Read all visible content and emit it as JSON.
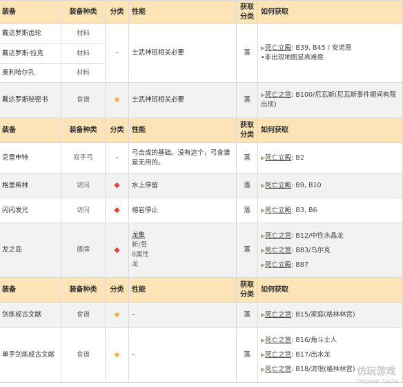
{
  "headers": {
    "equip": "装备",
    "type": "装备种类",
    "cat": "分类",
    "perf": "性能",
    "get1": "获取",
    "get2": "分类",
    "how": "如何获取"
  },
  "rows": [
    {
      "name": "戴达罗斯齿轮",
      "type": "材料"
    },
    {
      "name": "戴达罗斯·拉克",
      "type": "材料"
    },
    {
      "name": "奥利哈尔孔",
      "type": "材料"
    }
  ],
  "group1": {
    "cat": "–",
    "perf": "士武神班相关必要",
    "get": "落",
    "src1_prefix": "▶",
    "src1_link": "死亡立殿",
    "src1_rest": ": B39, B45 / 安诺恩",
    "src2": "•非出现地图是高难度"
  },
  "secret": {
    "name": "戴达罗斯秘密书",
    "type": "食谱",
    "cat": "★",
    "perf": "士武神班相关必要",
    "get": "落",
    "src_link": "死亡之宫",
    "src_rest": ": B100/尼瓦斯(尼瓦斯事件期间有限",
    "src_rest2": "出现)"
  },
  "sec2": [
    {
      "name": "克雷申特",
      "type": "双手弓",
      "cat": "–",
      "perf1": "弓合成的基础。没有这个，弓食谱",
      "perf2": "是无用的。",
      "get": "落",
      "link": "死亡立殿",
      "rest": ": B2"
    },
    {
      "name": "格里希林",
      "type": "访问",
      "cat": "◆",
      "perf1": "水上停留",
      "perf2": "",
      "get": "落",
      "link": "死亡立殿",
      "rest": ": B9, B10"
    },
    {
      "name": "闪闪发光",
      "type": "访问",
      "cat": "◆",
      "perf1": "熔岩停止",
      "perf2": "",
      "get": "落",
      "link": "死亡立殿",
      "rest": ": B3, B6"
    }
  ],
  "dragon": {
    "name": "龙之岛",
    "type": "盾牌",
    "cat": "◆",
    "perf": [
      "龙集",
      "新/贯",
      "8属性",
      "龙"
    ],
    "get": "落",
    "srcs": [
      {
        "link": "死亡之宫",
        "rest": ": B12/中性水晶龙"
      },
      {
        "link": "死亡之宫",
        "rest": ": B83/乌尔克"
      },
      {
        "link": "死亡立殿",
        "rest": ": B87"
      }
    ]
  },
  "sec3": [
    {
      "name": "剑炼成古文献",
      "type": "食谱",
      "cat": "★",
      "perf": "–",
      "get": "落",
      "srcs": [
        {
          "link": "死亡之宫",
          "rest": ": B15/家庭(格林林宫)"
        }
      ]
    },
    {
      "name": "单手剑炼成古文献",
      "type": "食谱",
      "cat": "★",
      "perf": "–",
      "get": "落",
      "srcs": [
        {
          "link": "死亡之宫",
          "rest": ": B16/角斗士人"
        },
        {
          "link": "死亡之宫",
          "rest": ": B17/出水龙"
        },
        {
          "link": "死亡之宫",
          "rest": ": B18/流氓(格林林宫)"
        }
      ]
    }
  ],
  "watermark": {
    "cn": "仿玩游戏",
    "en": "fangwan Game"
  }
}
